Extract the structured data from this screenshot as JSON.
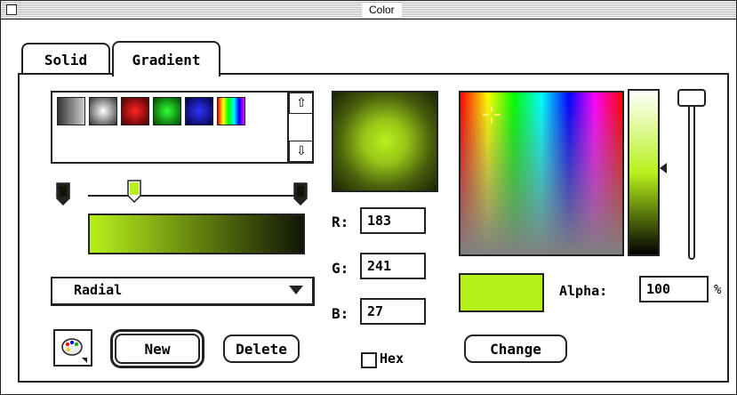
{
  "window": {
    "title": "Color"
  },
  "tabs": [
    {
      "label": "Solid",
      "active": false
    },
    {
      "label": "Gradient",
      "active": true
    }
  ],
  "swatches": [
    {
      "name": "gray-linear",
      "colors": [
        "#333333",
        "#cccccc"
      ]
    },
    {
      "name": "gray-radial",
      "colors": [
        "#ffffff",
        "#333333"
      ]
    },
    {
      "name": "red",
      "colors": [
        "#ff2222",
        "#440000"
      ]
    },
    {
      "name": "green",
      "colors": [
        "#33ff33",
        "#004400"
      ]
    },
    {
      "name": "blue",
      "colors": [
        "#3333ff",
        "#000044"
      ]
    },
    {
      "name": "rainbow",
      "colors": [
        "#ff0000",
        "#ffff00",
        "#00ff00",
        "#00ffff",
        "#0000ff",
        "#ff00ff"
      ]
    }
  ],
  "gradient": {
    "type_label": "Radial",
    "start_color": "#b7f11b",
    "end_color": "#101507"
  },
  "color": {
    "r_label": "R:",
    "g_label": "G:",
    "b_label": "B:",
    "r": "183",
    "g": "241",
    "b": "27",
    "hex_label": "Hex",
    "hex_checked": false,
    "current": "#b7f11b",
    "alpha_label": "Alpha:",
    "alpha": "100",
    "alpha_unit": "%"
  },
  "buttons": {
    "new_label": "New",
    "delete_label": "Delete",
    "change_label": "Change"
  },
  "icons": {
    "palette": "palette-icon",
    "crosshair": "crosshair-icon",
    "scroll_up": "arrow-up-icon",
    "scroll_down": "arrow-down-icon",
    "dropdown": "triangle-down-icon",
    "pointer": "triangle-left-icon"
  }
}
